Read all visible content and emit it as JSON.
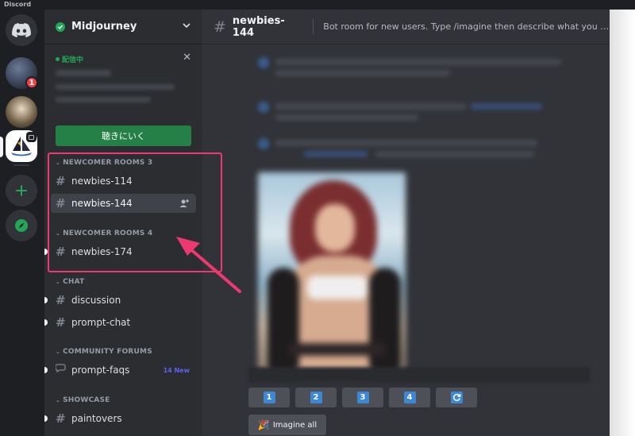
{
  "window": {
    "title": "Discord"
  },
  "rail": {
    "unread_badge": "1"
  },
  "server": {
    "name": "Midjourney"
  },
  "event": {
    "live_label": "配信中",
    "listen_button": "聴きにいく"
  },
  "categories": [
    {
      "label": "NEWCOMER ROOMS 3"
    },
    {
      "label": "NEWCOMER ROOMS 4"
    },
    {
      "label": "CHAT"
    },
    {
      "label": "COMMUNITY FORUMS"
    },
    {
      "label": "SHOWCASE"
    }
  ],
  "channels": {
    "newbies_114": "newbies-114",
    "newbies_144": "newbies-144",
    "newbies_174": "newbies-174",
    "discussion": "discussion",
    "prompt_chat": "prompt-chat",
    "prompt_faqs": "prompt-faqs",
    "prompt_faqs_badge": "14 New",
    "paintovers": "paintovers"
  },
  "header": {
    "channel": "newbies-144",
    "topic": "Bot room for new users. Type /imagine then describe what you want to dra..."
  },
  "upscale_buttons": [
    "1",
    "2",
    "3",
    "4"
  ],
  "imagine_all": {
    "emoji": "🎉",
    "label": "Imagine all"
  },
  "colors": {
    "highlight": "#ee3872",
    "accent_green": "#248046",
    "keycap_blue": "#3c88d4"
  }
}
